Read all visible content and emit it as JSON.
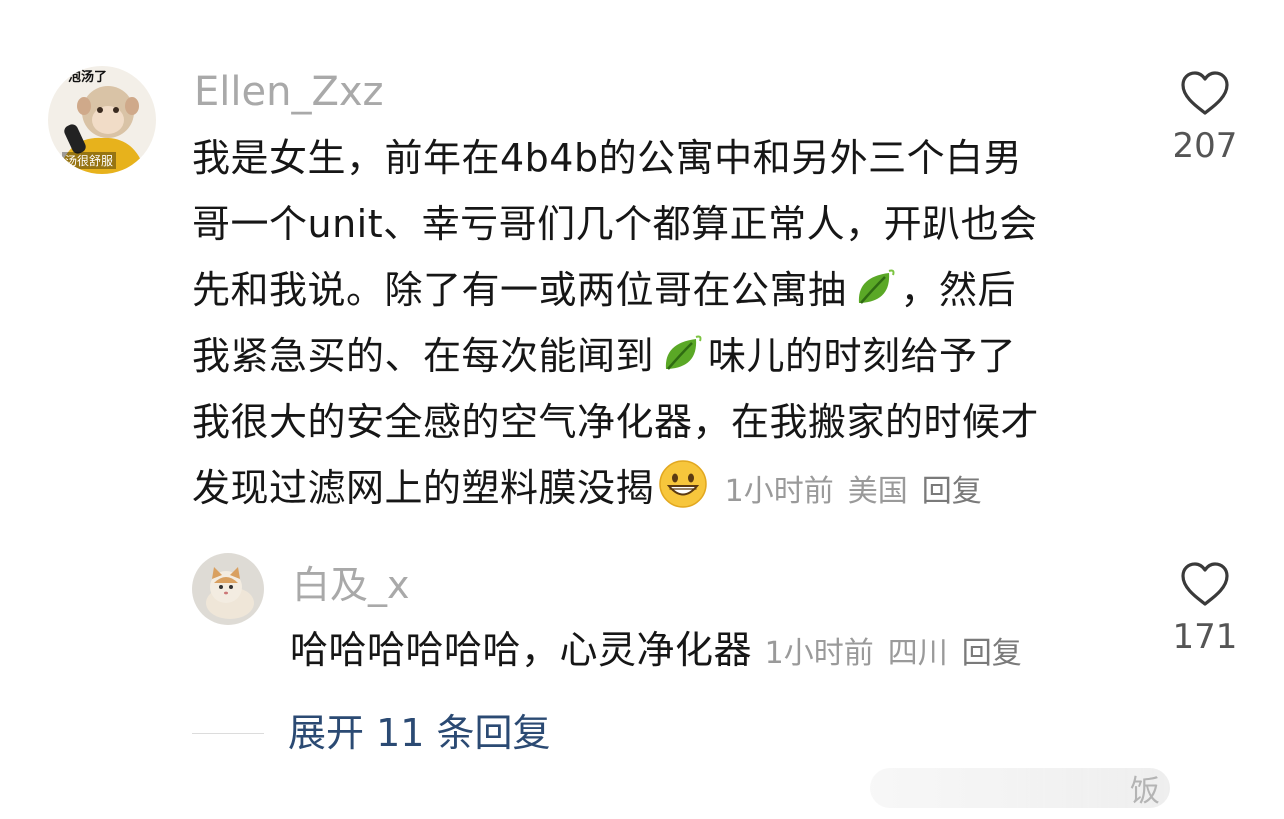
{
  "comment": {
    "avatar_caption_top": "泡汤了",
    "avatar_caption_bottom": "汤很舒服",
    "username": "Ellen_Zxz",
    "lines": [
      "我是女生，前年在4b4b的公寓中和另外三个白男",
      "哥一个unit、幸亏哥们几个都算正常人，开趴也会"
    ],
    "line3_before": "先和我说。除了有一或两位哥在公寓抽",
    "line3_after": "，然后",
    "line4_before": "我紧急买的、在每次能闻到",
    "line4_after": "味儿的时刻给予了",
    "line5": "我很大的安全感的空气净化器，在我搬家的时候才",
    "line6": "发现过滤网上的塑料膜没揭",
    "time": "1小时前",
    "location": "美国",
    "reply_label": "回复",
    "like_count": "207",
    "emoji_leaf": "leaf-icon",
    "emoji_smile": "grinning-face-icon"
  },
  "reply": {
    "username": "白及_x",
    "text": "哈哈哈哈哈哈，心灵净化器",
    "time": "1小时前",
    "location": "四川",
    "reply_label": "回复",
    "like_count": "171"
  },
  "expand": {
    "label": "展开 11 条回复"
  },
  "watermark": {
    "text": "饭"
  },
  "colors": {
    "text": "#161616",
    "meta": "#9a9a9a",
    "username": "#a9a9a9",
    "link": "#2b4a73"
  }
}
